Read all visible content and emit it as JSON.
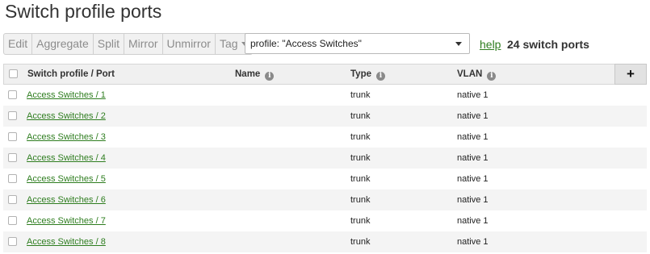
{
  "page": {
    "title": "Switch profile ports"
  },
  "toolbar": {
    "buttons": [
      "Edit",
      "Aggregate",
      "Split",
      "Mirror",
      "Unmirror"
    ],
    "tag_label": "Tag"
  },
  "filter": {
    "value": "profile: \"Access Switches\""
  },
  "help_label": "help",
  "port_count": "24 switch ports",
  "table": {
    "headers": {
      "port": "Switch profile / Port",
      "name": "Name",
      "type": "Type",
      "vlan": "VLAN"
    },
    "add_label": "+",
    "rows": [
      {
        "port": "Access Switches / 1",
        "name": "",
        "type": "trunk",
        "vlan": "native 1"
      },
      {
        "port": "Access Switches / 2",
        "name": "",
        "type": "trunk",
        "vlan": "native 1"
      },
      {
        "port": "Access Switches / 3",
        "name": "",
        "type": "trunk",
        "vlan": "native 1"
      },
      {
        "port": "Access Switches / 4",
        "name": "",
        "type": "trunk",
        "vlan": "native 1"
      },
      {
        "port": "Access Switches / 5",
        "name": "",
        "type": "trunk",
        "vlan": "native 1"
      },
      {
        "port": "Access Switches / 6",
        "name": "",
        "type": "trunk",
        "vlan": "native 1"
      },
      {
        "port": "Access Switches / 7",
        "name": "",
        "type": "trunk",
        "vlan": "native 1"
      },
      {
        "port": "Access Switches / 8",
        "name": "",
        "type": "trunk",
        "vlan": "native 1"
      }
    ]
  },
  "colors": {
    "link": "#2e7d1f",
    "header_bg": "#f0f0f0",
    "alt_row": "#f4f4f4"
  }
}
